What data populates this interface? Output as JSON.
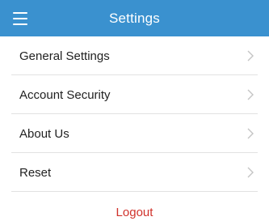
{
  "header": {
    "title": "Settings",
    "menu_icon": "hamburger-menu-icon",
    "background_color": "#3a91cf"
  },
  "settings": {
    "items": [
      {
        "label": "General Settings",
        "icon": "chevron-right-icon"
      },
      {
        "label": "Account Security",
        "icon": "chevron-right-icon"
      },
      {
        "label": "About Us",
        "icon": "chevron-right-icon"
      },
      {
        "label": "Reset",
        "icon": "chevron-right-icon"
      }
    ]
  },
  "footer": {
    "logout_label": "Logout",
    "logout_color": "#d0322b"
  }
}
